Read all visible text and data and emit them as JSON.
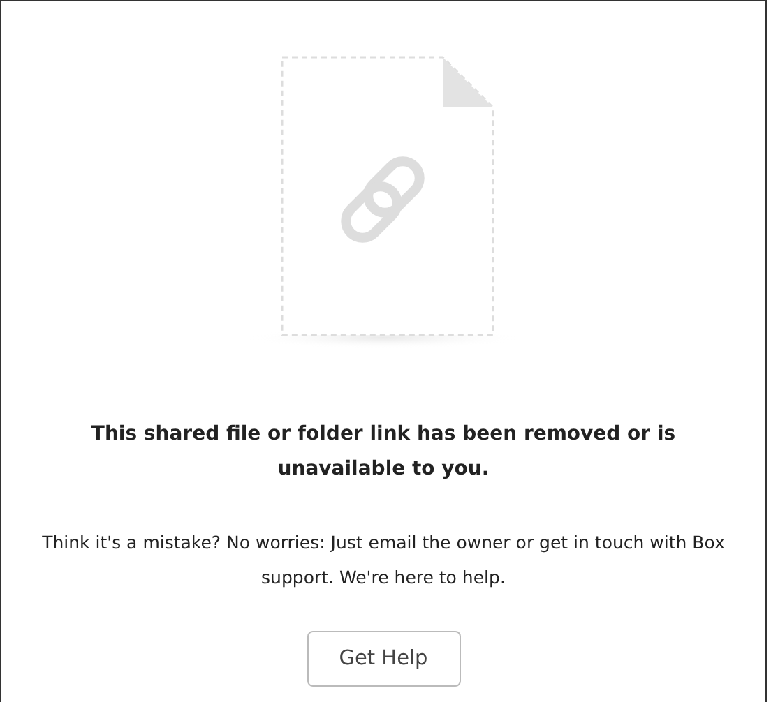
{
  "message": {
    "title": "This shared file or folder link has been removed or is unavailable to you.",
    "body": "Think it's a mistake? No worries: Just email the owner or get in touch with Box support. We're here to help."
  },
  "buttons": [
    {
      "label": "Get Help"
    }
  ]
}
